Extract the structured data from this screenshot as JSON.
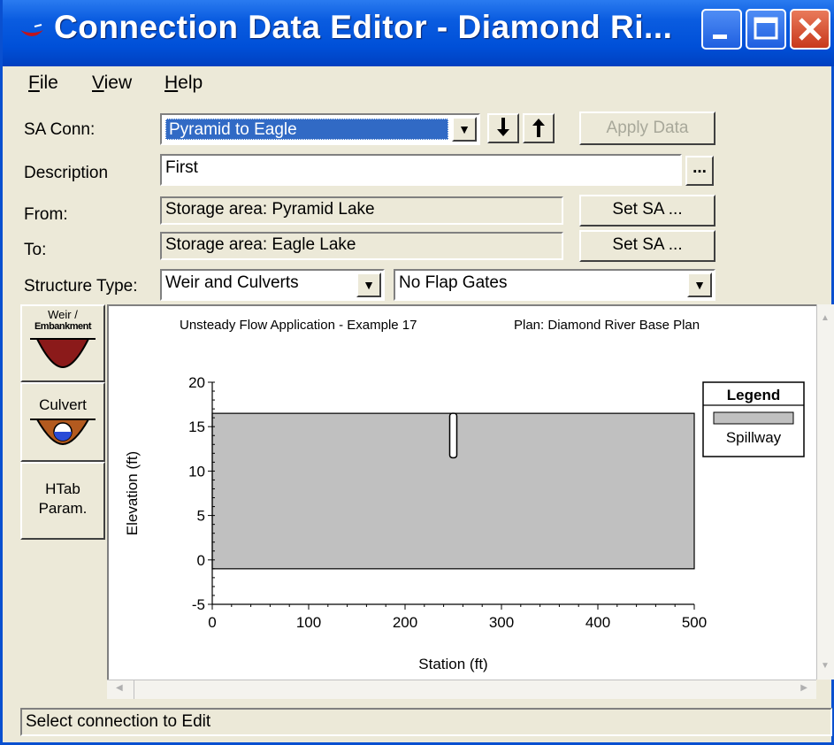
{
  "window": {
    "title": "Connection Data Editor - Diamond Ri..."
  },
  "menu": {
    "file": "File",
    "view": "View",
    "help": "Help"
  },
  "form": {
    "sa_conn_label": "SA Conn:",
    "sa_conn_value": "Pyramid to Eagle",
    "apply_data": "Apply Data",
    "description_label": "Description",
    "description_value": "First",
    "ellipsis": "...",
    "from_label": "From:",
    "from_value": "Storage area: Pyramid Lake",
    "to_label": "To:",
    "to_value": "Storage area: Eagle Lake",
    "set_sa": "Set SA ...",
    "structure_type_label": "Structure Type:",
    "structure_type_value": "Weir and Culverts",
    "flap_gates_value": "No Flap Gates"
  },
  "tabs": {
    "weir_line1": "Weir /",
    "weir_line2": "Embankment",
    "culvert": "Culvert",
    "htab_line1": "HTab",
    "htab_line2": "Param."
  },
  "status": "Select connection to Edit",
  "chart_data": {
    "type": "area",
    "title": "Unsteady Flow Application - Example 17",
    "subtitle": "Plan: Diamond River Base Plan",
    "xlabel": "Station (ft)",
    "ylabel": "Elevation (ft)",
    "xlim": [
      0,
      500
    ],
    "ylim": [
      -5,
      20
    ],
    "xticks": [
      "0",
      "100",
      "200",
      "300",
      "400",
      "500"
    ],
    "yticks": [
      "20",
      "15",
      "10",
      "5",
      "0",
      "-5"
    ],
    "legend_title": "Legend",
    "legend_position": "top-right",
    "series": [
      {
        "name": "Spillway",
        "color": "#c0c0c0",
        "x": [
          0,
          500
        ],
        "y_bottom": -1,
        "y_top": 16.5
      }
    ],
    "culvert_marker": {
      "x": 250,
      "y_bottom": 11.5,
      "y_top": 16.5
    }
  }
}
